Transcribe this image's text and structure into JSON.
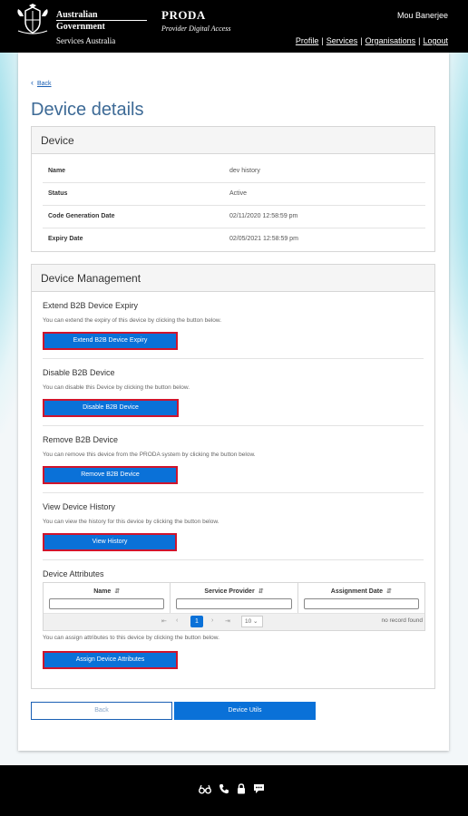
{
  "header": {
    "gov_line1": "Australian Government",
    "gov_line2": "Services Australia",
    "app_title": "PRODA",
    "app_subtitle": "Provider Digital Access",
    "user_name": "Mou Banerjee",
    "nav": [
      "Profile",
      "Services",
      "Organisations",
      "Logout"
    ]
  },
  "page": {
    "back_link": "Back",
    "title": "Device details"
  },
  "device": {
    "heading": "Device",
    "rows": [
      {
        "label": "Name",
        "value": "dev history"
      },
      {
        "label": "Status",
        "value": "Active"
      },
      {
        "label": "Code Generation Date",
        "value": "02/11/2020 12:58:59 pm"
      },
      {
        "label": "Expiry Date",
        "value": "02/05/2021 12:58:59 pm"
      }
    ]
  },
  "management": {
    "heading": "Device Management",
    "sections": [
      {
        "title": "Extend B2B Device Expiry",
        "desc": "You can extend the expiry of this device by clicking the button below.",
        "button": "Extend B2B Device Expiry"
      },
      {
        "title": "Disable B2B Device",
        "desc": "You can disable this Device by clicking the button below.",
        "button": "Disable B2B Device"
      },
      {
        "title": "Remove B2B Device",
        "desc": "You can remove this device from the PRODA system by clicking the button below.",
        "button": "Remove B2B Device"
      },
      {
        "title": "View Device History",
        "desc": "You can view the history for this device by clicking the button below.",
        "button": "View History"
      }
    ],
    "attributes": {
      "title": "Device Attributes",
      "columns": [
        "Name",
        "Service Provider",
        "Assignment Date"
      ],
      "pager": {
        "current_page": "1",
        "page_size": "10",
        "empty_text": "no record found"
      },
      "desc": "You can assign attributes to this device by clicking the button below.",
      "button": "Assign Device Attributes"
    }
  },
  "footer_buttons": {
    "back": "Back",
    "utils": "Device Utils"
  },
  "colors": {
    "primary": "#0a71d8",
    "highlight_border": "#d0142c",
    "title": "#3d6a96",
    "header_bg": "#000000"
  }
}
